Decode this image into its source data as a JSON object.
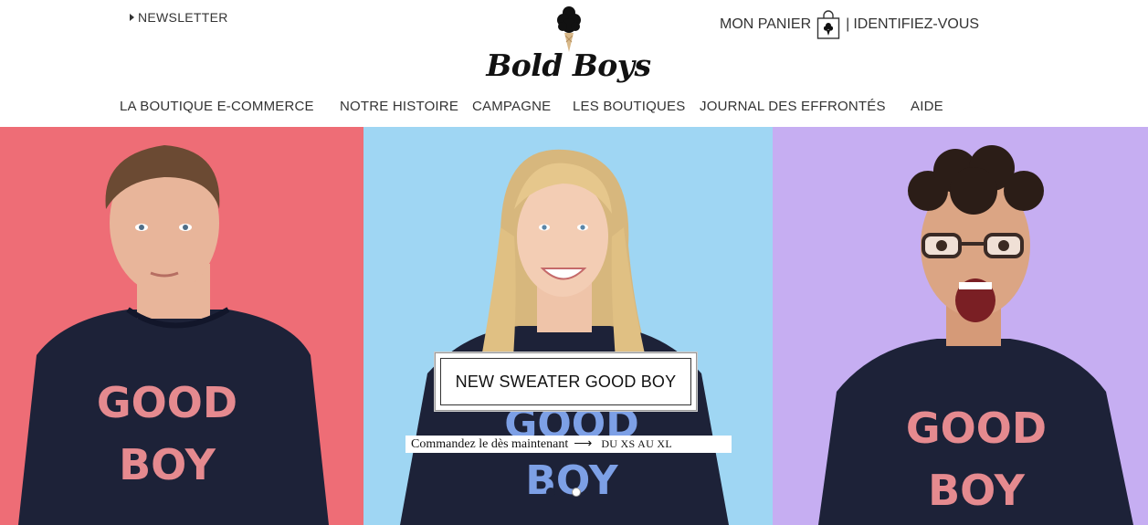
{
  "header": {
    "newsletter_label": "NEWSLETTER",
    "logo_text": "Bold Boys",
    "cart_label": "MON PANIER",
    "separator": "|",
    "login_label": "IDENTIFIEZ-VOUS"
  },
  "nav": {
    "items": [
      {
        "label": "LA BOUTIQUE E-COMMERCE"
      },
      {
        "label": "NOTRE HISTOIRE"
      },
      {
        "label": "CAMPAGNE"
      },
      {
        "label": "LES BOUTIQUES"
      },
      {
        "label": "JOURNAL DES EFFRONTÉS"
      },
      {
        "label": "AIDE"
      }
    ]
  },
  "hero": {
    "panels": [
      {
        "background": "#ee6d76",
        "sweater_text_line1": "GOOD",
        "sweater_text_line2": "BOY",
        "sweater_text_color": "#e58a8f"
      },
      {
        "background": "#9fd6f3",
        "sweater_text_line1": "GOOD",
        "sweater_text_line2": "BOY",
        "sweater_text_color": "#7da0e6"
      },
      {
        "background": "#c6aef2",
        "sweater_text_line1": "GOOD",
        "sweater_text_line2": "BOY",
        "sweater_text_color": "#e58a8f"
      }
    ],
    "cta_title": "NEW SWEATER GOOD BOY",
    "order_text": "Commandez le dès maintenant",
    "order_arrow": "⟶",
    "sizes_text": "DU XS AU XL",
    "carousel": {
      "count": 2,
      "active_index": 1
    }
  },
  "colors": {
    "sweater": "#1d2238",
    "skin": "#e8b59a",
    "text": "#333333"
  }
}
